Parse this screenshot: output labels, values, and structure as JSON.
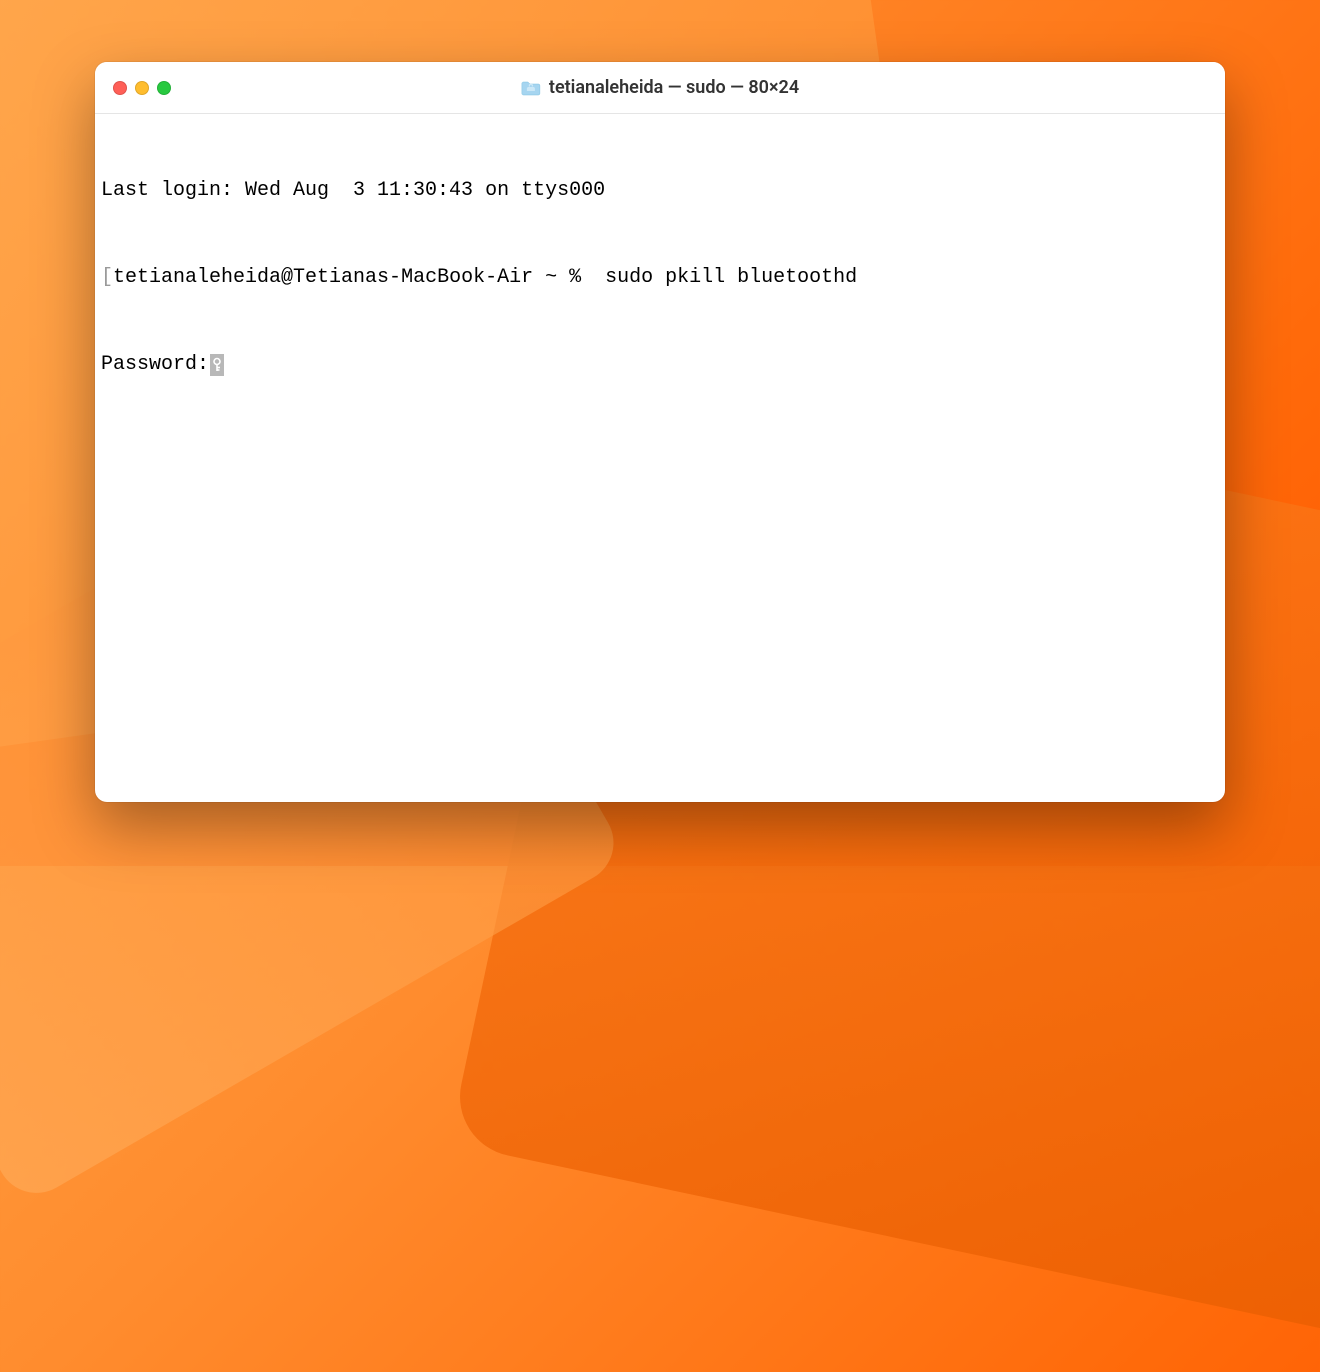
{
  "window": {
    "title": "tetianaleheida — sudo — 80×24"
  },
  "terminal": {
    "last_login": "Last login: Wed Aug  3 11:30:43 on ttys000",
    "prompt": "tetianaleheida@Tetianas-MacBook-Air ~ % ",
    "command": " sudo pkill bluetoothd",
    "password_prompt": "Password:"
  }
}
